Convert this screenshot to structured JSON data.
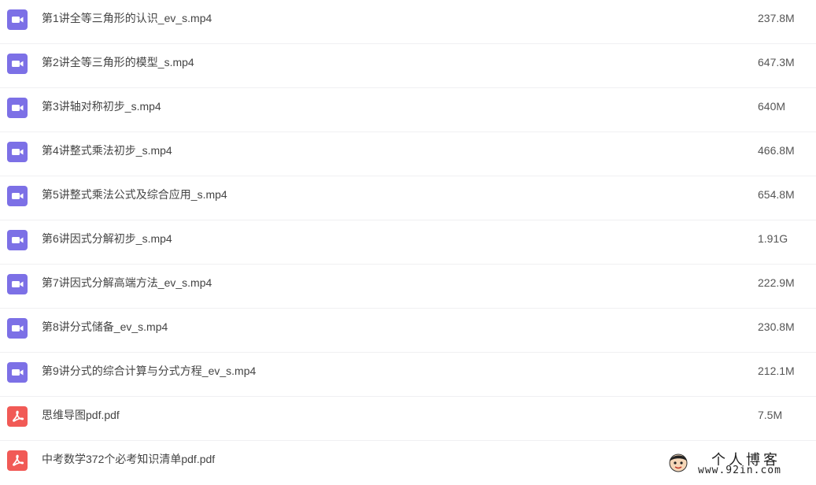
{
  "files": [
    {
      "name": "第1讲全等三角形的认识_ev_s.mp4",
      "size": "237.8M",
      "icon": "video-file-icon"
    },
    {
      "name": "第2讲全等三角形的模型_s.mp4",
      "size": "647.3M",
      "icon": "video-file-icon"
    },
    {
      "name": "第3讲轴对称初步_s.mp4",
      "size": "640M",
      "icon": "video-file-icon"
    },
    {
      "name": "第4讲整式乘法初步_s.mp4",
      "size": "466.8M",
      "icon": "video-file-icon"
    },
    {
      "name": "第5讲整式乘法公式及综合应用_s.mp4",
      "size": "654.8M",
      "icon": "video-file-icon"
    },
    {
      "name": "第6讲因式分解初步_s.mp4",
      "size": "1.91G",
      "icon": "video-file-icon"
    },
    {
      "name": "第7讲因式分解高端方法_ev_s.mp4",
      "size": "222.9M",
      "icon": "video-file-icon"
    },
    {
      "name": "第8讲分式储备_ev_s.mp4",
      "size": "230.8M",
      "icon": "video-file-icon"
    },
    {
      "name": "第9讲分式的综合计算与分式方程_ev_s.mp4",
      "size": "212.1M",
      "icon": "video-file-icon"
    },
    {
      "name": "思维导图pdf.pdf",
      "size": "7.5M",
      "icon": "pdf-file-icon"
    },
    {
      "name": "中考数学372个必考知识清单pdf.pdf",
      "size": "",
      "icon": "pdf-file-icon"
    }
  ],
  "watermark": {
    "title": "个人博客",
    "url": "www.92in.com"
  },
  "colors": {
    "video_icon": "#7c70e6",
    "pdf_icon": "#f15a56",
    "row_divider": "#f0f0f2"
  }
}
